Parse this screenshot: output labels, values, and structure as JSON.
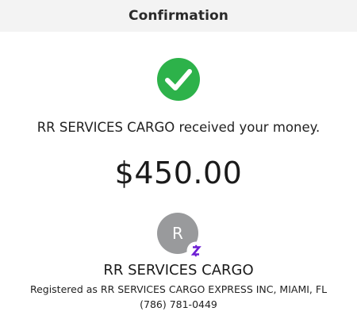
{
  "header": {
    "title": "Confirmation",
    "background_color": "#f3f3f3"
  },
  "status": {
    "icon": "check-circle-icon",
    "color": "#2db24a",
    "message": "RR SERVICES CARGO received your money."
  },
  "payment": {
    "amount": "$450.00"
  },
  "recipient": {
    "avatar_initial": "R",
    "avatar_color": "#999a9c",
    "badge_icon": "zelle-icon",
    "badge_color": "#6d1ed4",
    "name": "RR SERVICES CARGO",
    "registered_as": "Registered as RR SERVICES CARGO EXPRESS INC, MIAMI, FL",
    "phone": "(786) 781-0449"
  }
}
